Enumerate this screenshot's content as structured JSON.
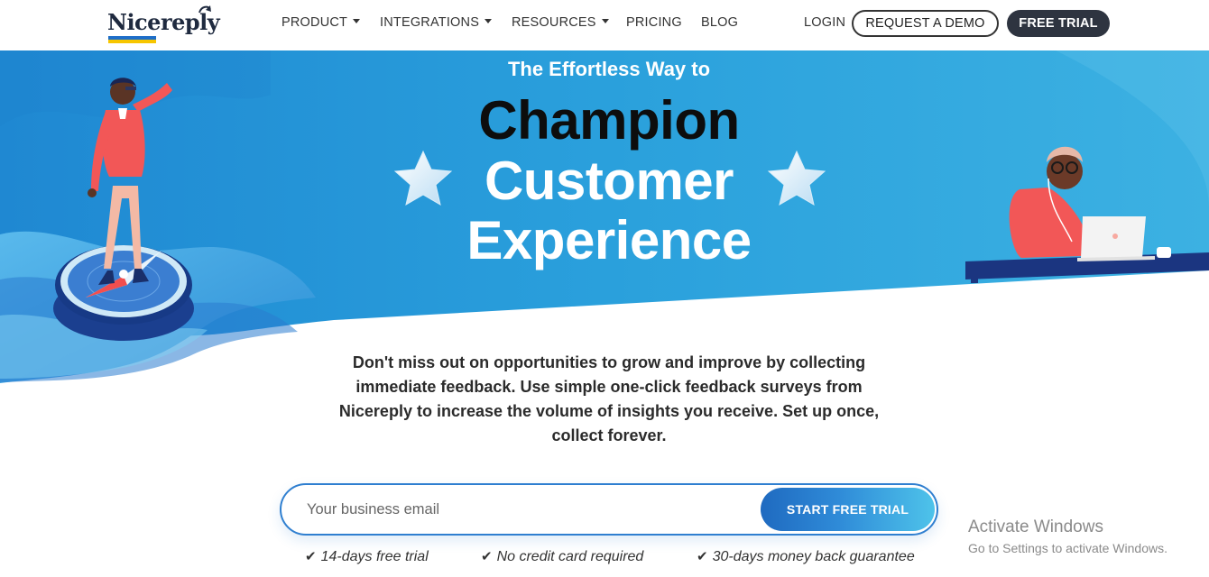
{
  "brand": {
    "logo_text": "Nicereply",
    "colors": {
      "flag_blue": "#1e6ec8",
      "flag_yellow": "#f7c600",
      "hero_blue": "#2a9fd8",
      "dark": "#2e3440",
      "accent_start": "#1f6ac0",
      "accent_end": "#4ec3ea"
    }
  },
  "nav": {
    "items": [
      {
        "label": "PRODUCT",
        "dropdown": true
      },
      {
        "label": "INTEGRATIONS",
        "dropdown": true
      },
      {
        "label": "RESOURCES",
        "dropdown": true
      },
      {
        "label": "PRICING",
        "dropdown": false
      },
      {
        "label": "BLOG",
        "dropdown": false
      }
    ],
    "login_label": "LOGIN",
    "demo_label": "REQUEST A DEMO",
    "trial_label": "FREE TRIAL"
  },
  "hero": {
    "subtitle": "The Effortless Way to",
    "line1": "Champion",
    "line2": "Customer",
    "line3": "Experience",
    "description": "Don't miss out on opportunities to grow and improve by collecting immediate feedback. Use simple one-click feedback surveys from Nicereply to increase the volume of insights you receive. Set up once, collect forever."
  },
  "signup": {
    "email_placeholder": "Your business email",
    "email_value": "",
    "submit_label": "START FREE TRIAL"
  },
  "features": [
    {
      "icon": "check-icon",
      "text": "14-days free trial"
    },
    {
      "icon": "check-icon",
      "text": "No credit card required"
    },
    {
      "icon": "check-icon",
      "text": "30-days money back guarantee"
    }
  ],
  "watermark": {
    "title": "Activate Windows",
    "subtitle": "Go to Settings to activate Windows."
  }
}
